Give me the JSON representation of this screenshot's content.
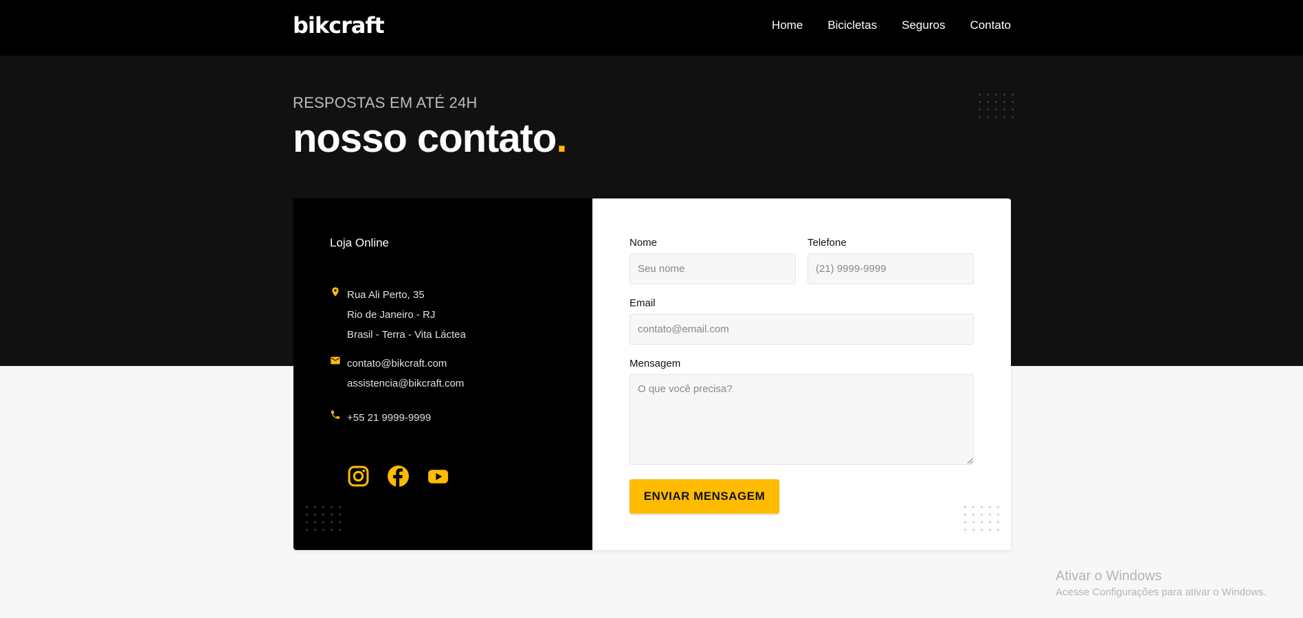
{
  "header": {
    "logo": "bikcraft",
    "nav": [
      "Home",
      "Bicicletas",
      "Seguros",
      "Contato"
    ]
  },
  "hero": {
    "subtitle": "RESPOSTAS EM ATÉ 24H",
    "title": "nosso contato",
    "title_dot": "."
  },
  "info": {
    "store_label": "Loja Online",
    "address": [
      "Rua Ali Perto, 35",
      "Rio de Janeiro - RJ",
      "Brasil - Terra - Vita Láctea"
    ],
    "emails": [
      "contato@bikcraft.com",
      "assistencia@bikcraft.com"
    ],
    "phone": "+55 21 9999-9999",
    "social_icons": [
      "instagram-icon",
      "facebook-icon",
      "youtube-icon"
    ]
  },
  "form": {
    "name_label": "Nome",
    "name_placeholder": "Seu nome",
    "phone_label": "Telefone",
    "phone_placeholder": "(21) 9999-9999",
    "email_label": "Email",
    "email_placeholder": "contato@email.com",
    "message_label": "Mensagem",
    "message_placeholder": "O que você precisa?",
    "submit_label": "ENVIAR MENSAGEM"
  },
  "windows_watermark": {
    "title": "Ativar o Windows",
    "subtitle": "Acesse Configurações para ativar o Windows."
  },
  "colors": {
    "accent": "#ffbb00",
    "header_bg": "#000000",
    "hero_bg": "#111111",
    "page_bg": "#f7f7f7"
  }
}
